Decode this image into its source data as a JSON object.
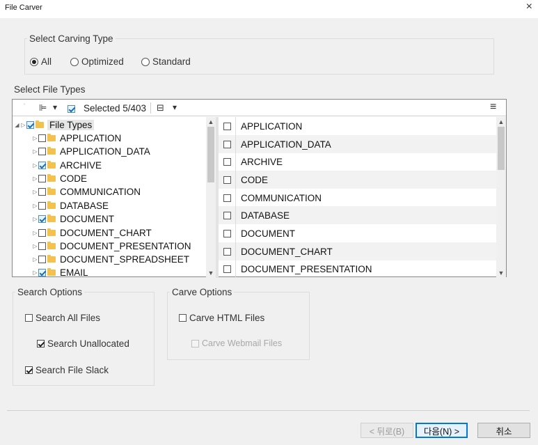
{
  "window": {
    "title": "File Carver",
    "close": "×"
  },
  "carving_type": {
    "legend": "Select Carving Type",
    "options": [
      {
        "label": "All",
        "selected": true
      },
      {
        "label": "Optimized",
        "selected": false
      },
      {
        "label": "Standard",
        "selected": false
      }
    ]
  },
  "file_types": {
    "label": "Select File Types",
    "toolbar": {
      "sort_icon": "⊫",
      "sort_dropdown": "▾",
      "selected_text": "Selected 5/403",
      "view_icon": "⊟",
      "view_dropdown": "▾",
      "menu_icon": "≡"
    },
    "tree": {
      "root": {
        "label": "File Types",
        "checked": true
      },
      "items": [
        {
          "label": "APPLICATION",
          "checked": false
        },
        {
          "label": "APPLICATION_DATA",
          "checked": false
        },
        {
          "label": "ARCHIVE",
          "checked": true
        },
        {
          "label": "CODE",
          "checked": false
        },
        {
          "label": "COMMUNICATION",
          "checked": false
        },
        {
          "label": "DATABASE",
          "checked": false
        },
        {
          "label": "DOCUMENT",
          "checked": true
        },
        {
          "label": "DOCUMENT_CHART",
          "checked": false
        },
        {
          "label": "DOCUMENT_PRESENTATION",
          "checked": false
        },
        {
          "label": "DOCUMENT_SPREADSHEET",
          "checked": false
        },
        {
          "label": "EMAIL",
          "checked": true
        }
      ]
    },
    "list": [
      {
        "label": "APPLICATION",
        "checked": false
      },
      {
        "label": "APPLICATION_DATA",
        "checked": false
      },
      {
        "label": "ARCHIVE",
        "checked": false
      },
      {
        "label": "CODE",
        "checked": false
      },
      {
        "label": "COMMUNICATION",
        "checked": false
      },
      {
        "label": "DATABASE",
        "checked": false
      },
      {
        "label": "DOCUMENT",
        "checked": false
      },
      {
        "label": "DOCUMENT_CHART",
        "checked": false
      },
      {
        "label": "DOCUMENT_PRESENTATION",
        "checked": false
      }
    ]
  },
  "search_options": {
    "legend": "Search Options",
    "items": [
      {
        "label": "Search All Files",
        "checked": false
      },
      {
        "label": "Search Unallocated",
        "checked": true
      },
      {
        "label": "Search File Slack",
        "checked": true
      }
    ]
  },
  "carve_options": {
    "legend": "Carve Options",
    "items": [
      {
        "label": "Carve HTML Files",
        "checked": false,
        "disabled": false
      },
      {
        "label": "Carve Webmail Files",
        "checked": false,
        "disabled": true
      }
    ]
  },
  "buttons": {
    "back": "< 뒤로(B)",
    "next": "다음(N) >",
    "cancel": "취소"
  }
}
